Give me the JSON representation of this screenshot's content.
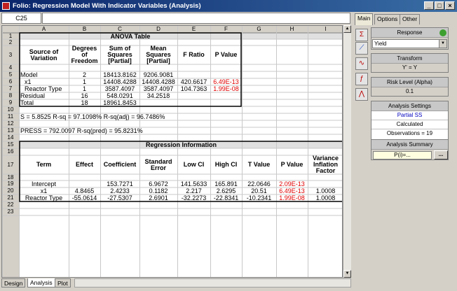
{
  "window": {
    "title": "Folio: Regression Model With Indicator Variables (Analysis)"
  },
  "formula_bar": {
    "cell_ref": "C25",
    "value": ""
  },
  "columns": [
    "A",
    "B",
    "C",
    "D",
    "E",
    "F",
    "G",
    "H",
    "I"
  ],
  "rows": [
    "1",
    "2",
    "3",
    "4",
    "5",
    "6",
    "7",
    "8",
    "9",
    "10",
    "11",
    "12",
    "13",
    "14",
    "15",
    "16",
    "17",
    "18",
    "19",
    "20",
    "21",
    "22",
    "23"
  ],
  "anova": {
    "title": "ANOVA Table",
    "headers": [
      "Source of Variation",
      "Degrees of Freedom",
      "Sum of Squares [Partial]",
      "Mean Squares [Partial]",
      "F Ratio",
      "P Value"
    ],
    "rows": [
      [
        "Model",
        "2",
        "18413.8162",
        "9206.9081",
        "",
        ""
      ],
      [
        "x1",
        "1",
        "14408.4288",
        "14408.4288",
        "420.6617",
        "6.49E-13"
      ],
      [
        "Reactor Type",
        "1",
        "3587.4097",
        "3587.4097",
        "104.7363",
        "1.99E-08"
      ],
      [
        "Residual",
        "16",
        "548.0291",
        "34.2518",
        "",
        ""
      ],
      [
        "Total",
        "18",
        "18961.8453",
        "",
        "",
        ""
      ]
    ]
  },
  "stats": {
    "line11": "S = 5.8525    R-sq = 97.1098%    R-sq(adj) = 96.7486%",
    "line13": "PRESS = 792.0097    R-sq(pred) = 95.8231%"
  },
  "regression": {
    "title": "Regression Information",
    "headers": [
      "Term",
      "Effect",
      "Coefficient",
      "Standard Error",
      "Low CI",
      "High CI",
      "T Value",
      "P Value",
      "Variance Inflation Factor"
    ],
    "rows": [
      [
        "Intercept",
        "",
        "153.7271",
        "6.9672",
        "141.5633",
        "165.891",
        "22.0646",
        "2.09E-13",
        ""
      ],
      [
        "x1",
        "4.8465",
        "2.4233",
        "0.1182",
        "2.217",
        "2.6295",
        "20.51",
        "6.49E-13",
        "1.0008"
      ],
      [
        "Reactor Type",
        "-55.0614",
        "-27.5307",
        "2.6901",
        "-32.2273",
        "-22.8341",
        "-10.2341",
        "1.99E-08",
        "1.0008"
      ]
    ]
  },
  "sheet_tabs": [
    "Design",
    "Analysis",
    "Plot"
  ],
  "right_panel": {
    "tabs": [
      "Main",
      "Options",
      "Other"
    ],
    "response_label": "Response",
    "response_value": "Yield",
    "transform_label": "Transform",
    "transform_value": "Y' = Y",
    "risk_label": "Risk Level (Alpha)",
    "risk_value": "0.1",
    "settings_label": "Analysis Settings",
    "settings_lines": [
      "Partial SS",
      "Calculated",
      "Observations = 19"
    ],
    "summary_label": "Analysis Summary",
    "summary_value": "P(i)=...",
    "summary_button": "..."
  },
  "colors": {
    "titlebar": "#0a246a",
    "pvalue_red": "#e00000",
    "highlight_blue": "#0000c0"
  }
}
